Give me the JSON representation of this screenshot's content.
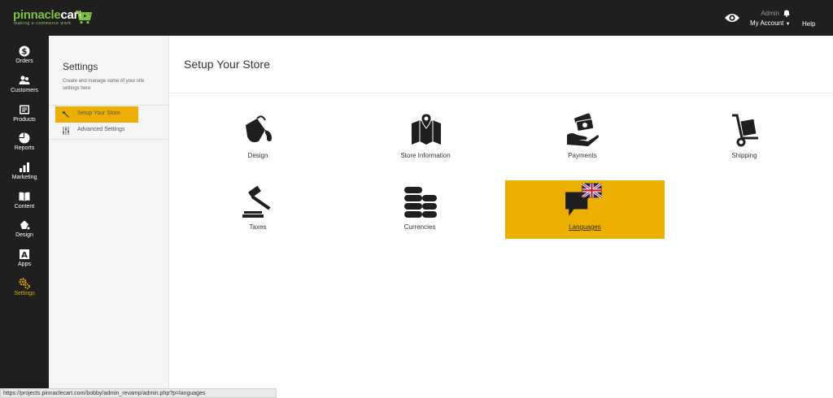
{
  "brand": {
    "name_part1": "pinnacle",
    "name_part2": "cart",
    "tagline": "making e-commerce work"
  },
  "topbar": {
    "user_name": "Admin",
    "account_label": "My Account",
    "help_label": "Help"
  },
  "nav": [
    {
      "label": "Orders",
      "icon": "dollar-icon"
    },
    {
      "label": "Customers",
      "icon": "users-icon"
    },
    {
      "label": "Products",
      "icon": "box-icon"
    },
    {
      "label": "Reports",
      "icon": "pie-icon"
    },
    {
      "label": "Marketing",
      "icon": "bars-icon"
    },
    {
      "label": "Content",
      "icon": "book-icon"
    },
    {
      "label": "Design",
      "icon": "paint-icon"
    },
    {
      "label": "Apps",
      "icon": "apps-icon"
    },
    {
      "label": "Settings",
      "icon": "gears-icon",
      "active": true
    }
  ],
  "settings_panel": {
    "title": "Settings",
    "description": "Create and manage some of your site settings here",
    "items": [
      {
        "label": "Setup Your Store",
        "active": true
      },
      {
        "label": "Advanced Settings"
      }
    ]
  },
  "main": {
    "title": "Setup Your Store",
    "tiles": [
      {
        "label": "Design",
        "icon": "paint-bucket-icon"
      },
      {
        "label": "Store Information",
        "icon": "map-icon"
      },
      {
        "label": "Payments",
        "icon": "money-hand-icon"
      },
      {
        "label": "Shipping",
        "icon": "hand-truck-icon"
      },
      {
        "label": "Taxes",
        "icon": "gavel-icon"
      },
      {
        "label": "Currencies",
        "icon": "coin-stacks-icon"
      },
      {
        "label": "Languages",
        "icon": "speech-flag-icon",
        "active": true
      }
    ]
  },
  "status_url": "https://projects.pinnaclecart.com/bobby/admin_revamp/admin.php?p=languages",
  "colors": {
    "accent": "#eeb000",
    "dark": "#1f1f1f",
    "brand_green": "#7cc242"
  }
}
